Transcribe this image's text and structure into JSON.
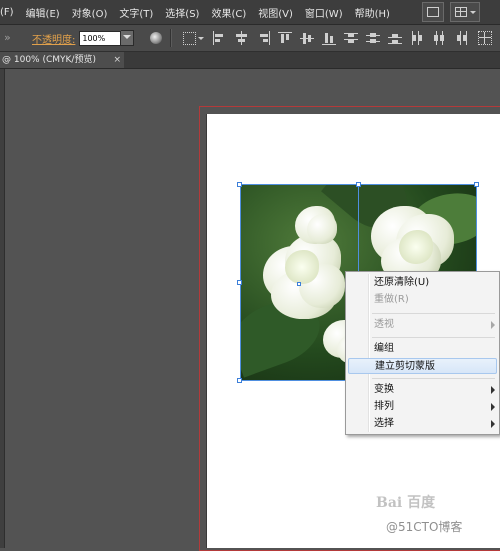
{
  "menubar": {
    "items": [
      "(F)",
      "编辑(E)",
      "对象(O)",
      "文字(T)",
      "选择(S)",
      "效果(C)",
      "视图(V)",
      "窗口(W)",
      "帮助(H)"
    ]
  },
  "control_bar": {
    "opacity_label": "不透明度:",
    "opacity_value": "100%"
  },
  "document_tab": {
    "title": "@ 100% (CMYK/预览)",
    "close": "×"
  },
  "context_menu": {
    "items": [
      {
        "label": "还原清除(U)",
        "enabled": true,
        "submenu": false
      },
      {
        "label": "重做(R)",
        "enabled": false,
        "submenu": false
      },
      {
        "label": "透视",
        "enabled": false,
        "submenu": true
      },
      {
        "label": "编组",
        "enabled": true,
        "submenu": false
      },
      {
        "label": "建立剪切蒙版",
        "enabled": true,
        "submenu": false,
        "highlighted": true
      },
      {
        "label": "变换",
        "enabled": true,
        "submenu": true
      },
      {
        "label": "排列",
        "enabled": true,
        "submenu": true
      },
      {
        "label": "选择",
        "enabled": true,
        "submenu": true
      }
    ]
  },
  "watermark": {
    "text": "@51CTO博客",
    "logo": "Bai 百度"
  },
  "colors": {
    "menubar_bg": "#3d3d3d",
    "workspace_bg": "#535353",
    "artboard_border": "#b43a3a",
    "selection": "#4f8fe0",
    "opacity_label": "#e2a14b"
  }
}
